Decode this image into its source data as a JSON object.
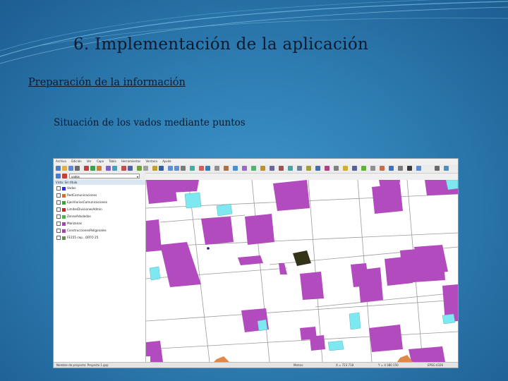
{
  "slide": {
    "title": "6. Implementación de la aplicación",
    "section_heading": "Preparación de la información",
    "bullet": "Situación de los vados mediante puntos"
  },
  "app": {
    "menu": [
      "Archivo",
      "Edición",
      "Ver",
      "Capa",
      "Tabla",
      "Herramientas",
      "Ventana",
      "Ayuda"
    ],
    "layer_select": "vados",
    "legend_title": "Vista: Sin título",
    "layers": [
      {
        "name": "Vados",
        "color": "#3030d0"
      },
      {
        "name": "RedComunicaciones",
        "color": "#d07030"
      },
      {
        "name": "EjesViariosComunicaciones",
        "color": "#40a040"
      },
      {
        "name": "LimitesDivisionesAdmin",
        "color": "#b03030"
      },
      {
        "name": "ZonasArboladas",
        "color": "#50b050"
      },
      {
        "name": "Manzanas",
        "color": "#a046b0"
      },
      {
        "name": "ConstruccionesPoligonales",
        "color": "#a046b0"
      },
      {
        "name": "FE155 cep...ORTO 25",
        "color": "#6a8a5a"
      }
    ],
    "status": {
      "left": "Nombre de proyecto: Proyecto 1.gvp",
      "units": "Metros",
      "x": "X = 723 718",
      "y": "Y = 4 380 150",
      "epsg": "EPSG:4326"
    }
  },
  "colors": {
    "building": "#b24bbd",
    "pool": "#7ee8f0",
    "selected": "#333318",
    "parcel_line": "#9a9a9a"
  }
}
